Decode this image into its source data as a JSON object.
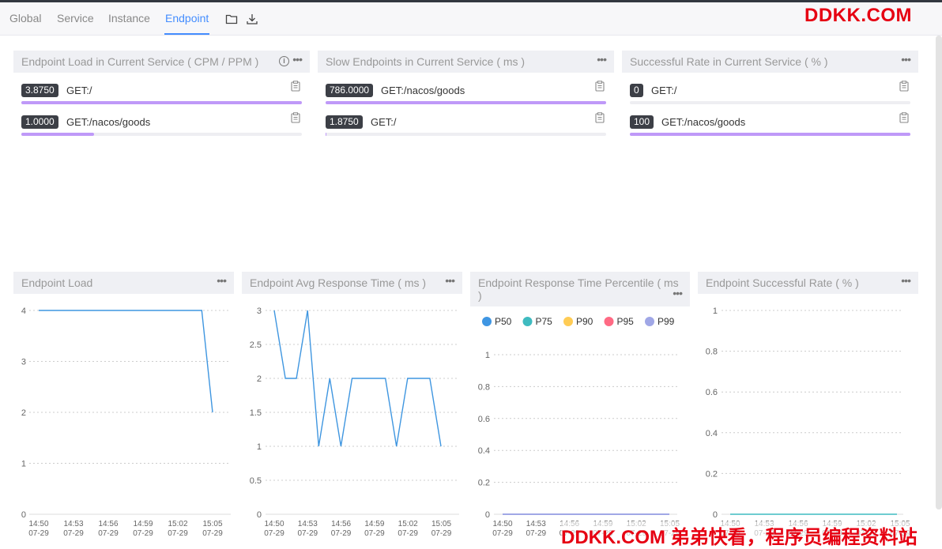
{
  "tabs": [
    {
      "label": "Global",
      "active": false
    },
    {
      "label": "Service",
      "active": false
    },
    {
      "label": "Instance",
      "active": false
    },
    {
      "label": "Endpoint",
      "active": true
    }
  ],
  "watermark": {
    "top": "DDKK.COM",
    "bottom": "DDKK.COM 弟弟快看，程序员编程资料站"
  },
  "panels_top": [
    {
      "title": "Endpoint Load in Current Service ( CPM / PPM )",
      "has_info": true,
      "rows": [
        {
          "value": "3.8750",
          "label": "GET:/",
          "fraction": 1.0
        },
        {
          "value": "1.0000",
          "label": "GET:/nacos/goods",
          "fraction": 0.258
        }
      ]
    },
    {
      "title": "Slow Endpoints in Current Service ( ms )",
      "has_info": false,
      "rows": [
        {
          "value": "786.0000",
          "label": "GET:/nacos/goods",
          "fraction": 1.0
        },
        {
          "value": "1.8750",
          "label": "GET:/",
          "fraction": 0.0024
        }
      ]
    },
    {
      "title": "Successful Rate in Current Service ( % )",
      "has_info": false,
      "rows": [
        {
          "value": "0",
          "label": "GET:/",
          "fraction": 0.0
        },
        {
          "value": "100",
          "label": "GET:/nacos/goods",
          "fraction": 1.0
        }
      ]
    }
  ],
  "colors": {
    "accent": "#448dfe",
    "bar_fill": "#bf99f8",
    "line": "#3f96e0",
    "badge": "#3c3f46",
    "watermark": "#e60012"
  },
  "chart_data": [
    {
      "type": "line",
      "title": "Endpoint Load",
      "x": [
        "14:50\n07-29",
        "14:53\n07-29",
        "14:56\n07-29",
        "14:59\n07-29",
        "15:02\n07-29",
        "15:05\n07-29"
      ],
      "series": [
        {
          "values": [
            4,
            4,
            4,
            4,
            4,
            4,
            4,
            4,
            4,
            4,
            4,
            4,
            4,
            4,
            4,
            4,
            2
          ]
        }
      ],
      "yticks": [
        0,
        1,
        2,
        3,
        4
      ],
      "ylim": [
        0,
        4
      ],
      "grid": true
    },
    {
      "type": "line",
      "title": "Endpoint Avg Response Time ( ms )",
      "x": [
        "14:50\n07-29",
        "14:53\n07-29",
        "14:56\n07-29",
        "14:59\n07-29",
        "15:02\n07-29",
        "15:05\n07-29"
      ],
      "series": [
        {
          "values": [
            3,
            2,
            2,
            3,
            1,
            2,
            1,
            2,
            2,
            2,
            2,
            1,
            2,
            2,
            2,
            1
          ]
        }
      ],
      "yticks": [
        0,
        0.5,
        1,
        1.5,
        2,
        2.5,
        3
      ],
      "ylim": [
        0,
        3
      ],
      "grid": true
    },
    {
      "type": "line",
      "title": "Endpoint Response Time Percentile ( ms )",
      "legend": [
        "P50",
        "P75",
        "P90",
        "P95",
        "P99"
      ],
      "legend_colors": [
        "#3f96e3",
        "#3fbbc0",
        "#ffcc55",
        "#ff6a84",
        "#a0a7e6"
      ],
      "x": [
        "14:50\n07-29",
        "14:53\n07-29",
        "14:56\n07-29",
        "14:59\n07-29",
        "15:02\n07-29",
        "15:05\n07-29"
      ],
      "series": [
        {
          "name": "P50",
          "values": [
            0,
            0
          ]
        },
        {
          "name": "P75",
          "values": [
            0,
            0
          ]
        },
        {
          "name": "P90",
          "values": [
            0,
            0
          ]
        },
        {
          "name": "P95",
          "values": [
            0,
            0
          ]
        },
        {
          "name": "P99",
          "values": [
            0,
            0
          ]
        }
      ],
      "yticks": [
        0,
        0.2,
        0.4,
        0.6,
        0.8,
        1
      ],
      "ylim": [
        0,
        1
      ],
      "grid": true
    },
    {
      "type": "line",
      "title": "Endpoint Successful Rate ( % )",
      "x": [
        "14:50\n07-29",
        "14:53\n07-29",
        "14:56\n07-29",
        "14:59\n07-29",
        "15:02\n07-29",
        "15:05\n07-29"
      ],
      "series": [
        {
          "values": [
            0,
            0
          ]
        }
      ],
      "yticks": [
        0,
        0.2,
        0.4,
        0.6,
        0.8,
        1
      ],
      "ylim": [
        0,
        1
      ],
      "grid": true
    }
  ]
}
